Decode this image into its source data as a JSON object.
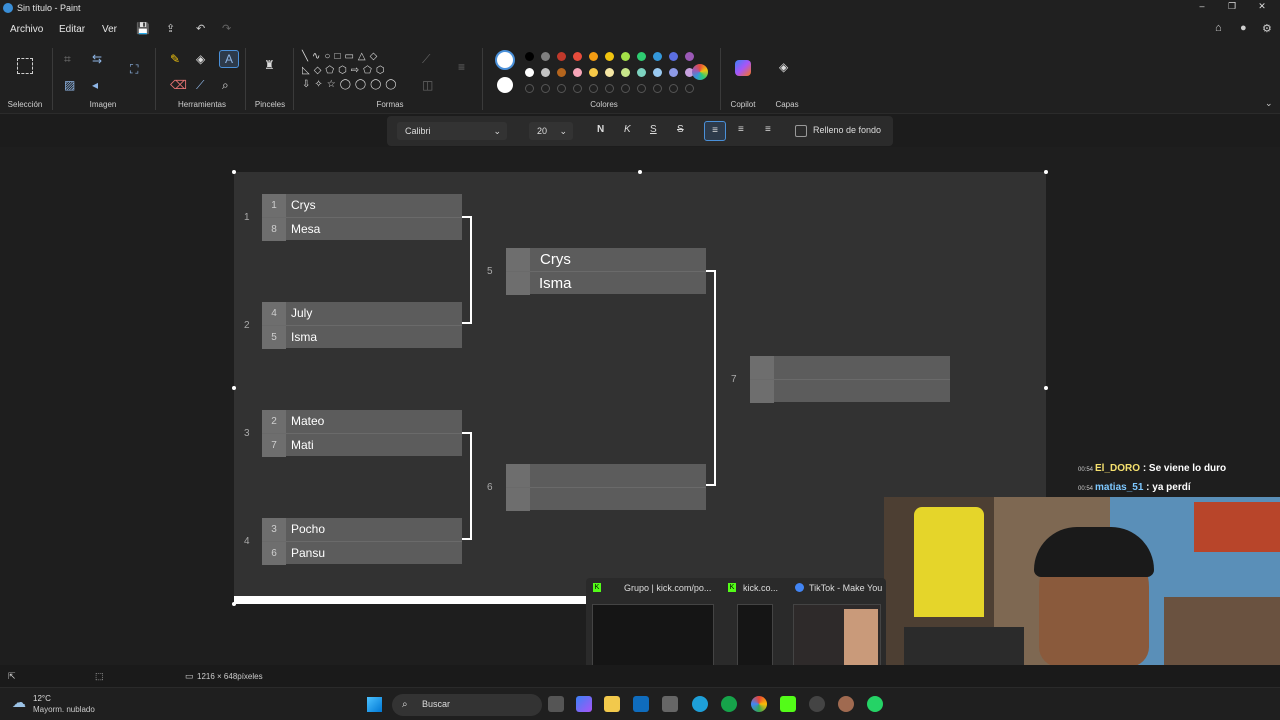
{
  "window": {
    "title": "Sin título - Paint"
  },
  "menu": {
    "file": "Archivo",
    "edit": "Editar",
    "view": "Ver"
  },
  "ribbon": {
    "groups": {
      "selection": "Selección",
      "image": "Imagen",
      "tools": "Herramientas",
      "brushes": "Pinceles",
      "shapes": "Formas",
      "colors": "Colores",
      "copilot": "Copilot",
      "layers": "Capas"
    }
  },
  "text_toolbar": {
    "font": "Calibri",
    "size": "20",
    "bold": "N",
    "italic": "K",
    "underline": "S",
    "strike": "S",
    "background_fill": "Relleno de fondo"
  },
  "bracket": {
    "round_numbers": [
      "1",
      "2",
      "3",
      "4",
      "5",
      "6",
      "7"
    ],
    "round1": [
      {
        "seed_top": "1",
        "name_top": "Crys",
        "seed_bottom": "8",
        "name_bottom": "Mesa"
      },
      {
        "seed_top": "4",
        "name_top": "July",
        "seed_bottom": "5",
        "name_bottom": "Isma"
      },
      {
        "seed_top": "2",
        "name_top": "Mateo",
        "seed_bottom": "7",
        "name_bottom": "Mati"
      },
      {
        "seed_top": "3",
        "name_top": "Pocho",
        "seed_bottom": "6",
        "name_bottom": "Pansu"
      }
    ],
    "semifinal_top": {
      "name_top": "Crys",
      "name_bottom": "Isma"
    },
    "semifinal_bottom": {
      "name_top": "",
      "name_bottom": ""
    },
    "final": {
      "name_top": "",
      "name_bottom": ""
    }
  },
  "statusbar": {
    "canvas_size": "1216 × 648píxeles"
  },
  "chat": [
    {
      "time": "00:54",
      "user": "El_DORO",
      "message": ": Se viene lo duro",
      "color": "#f5e06e"
    },
    {
      "time": "00:54",
      "user": "matias_51",
      "message": ": ya perdí",
      "color": "#7ec8ff"
    }
  ],
  "thumbnails": [
    {
      "title": "Grupo | kick.com/po..."
    },
    {
      "title": "kick.co..."
    },
    {
      "title": "TikTok - Make You..."
    }
  ],
  "taskbar": {
    "weather_temp": "12°C",
    "weather_desc": "Mayorm. nublado",
    "search_placeholder": "Buscar"
  },
  "colors": {
    "accent": "#4a90d9",
    "palette_row1": [
      "#000000",
      "#7f7f7f",
      "#c0392b",
      "#e74c3c",
      "#f39c12",
      "#f1c40f",
      "#a3e048",
      "#2ecc71",
      "#3498db",
      "#5b6ee1",
      "#9b59b6"
    ],
    "palette_row2": [
      "#ffffff",
      "#c3c3c3",
      "#b5651d",
      "#f7a5b8",
      "#f7c948",
      "#f5e6a3",
      "#c8e68a",
      "#7dd3c0",
      "#99c9f0",
      "#8e9ae6",
      "#c8a2e0"
    ]
  }
}
